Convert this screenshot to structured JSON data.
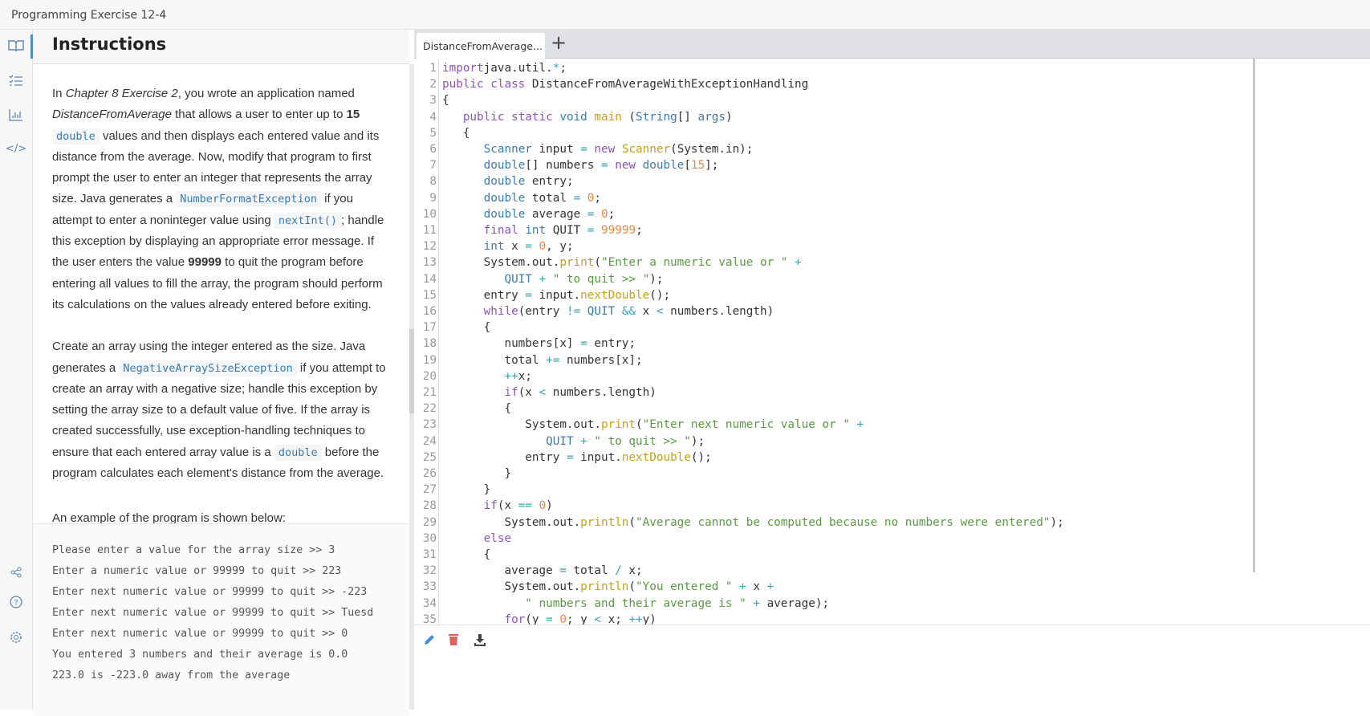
{
  "window": {
    "title": "Programming Exercise 12-4"
  },
  "rail": {
    "icons": [
      "book-icon",
      "checklist-icon",
      "chart-icon",
      "code-icon",
      "share-icon",
      "help-icon",
      "settings-icon"
    ]
  },
  "instructions": {
    "heading": "Instructions",
    "paragraphs": [
      [
        {
          "t": "In "
        },
        {
          "t": "Chapter 8 Exercise 2",
          "i": 1
        },
        {
          "t": ", you wrote an application named "
        },
        {
          "t": "DistanceFromAverage",
          "i": 1
        },
        {
          "t": " that allows a user to enter up to "
        },
        {
          "t": "15",
          "b": 1
        },
        {
          "t": " "
        },
        {
          "t": "double",
          "c": 1
        },
        {
          "t": " values and then displays each entered value and its distance from the average. Now, modify that program to first prompt the user to enter an integer that represents the array size. Java generates a "
        },
        {
          "t": "NumberFormatException",
          "c": 1
        },
        {
          "t": " if you attempt to enter a noninteger value using "
        },
        {
          "t": "nextInt()",
          "c": 1
        },
        {
          "t": "; handle this exception by displaying an appropriate error message. If the user enters the value "
        },
        {
          "t": "99999",
          "b": 1
        },
        {
          "t": " to quit the program before entering all values to fill the array, the program should perform its calculations on the values already entered before exiting."
        }
      ],
      [
        {
          "t": "Create an array using the integer entered as the size. Java generates a "
        },
        {
          "t": "NegativeArraySizeException",
          "c": 1
        },
        {
          "t": " if you attempt to create an array with a negative size; handle this exception by setting the array size to a default value of five. If the array is created successfully, use exception-handling techniques to ensure that each entered array value is a "
        },
        {
          "t": "double",
          "c": 1
        },
        {
          "t": " before the program calculates each element's distance from the average."
        }
      ],
      [
        {
          "t": "An example of the program is shown below:"
        }
      ]
    ],
    "console": [
      "Please enter a value for the array size >> 3",
      "Enter a numeric value or 99999 to quit >> 223",
      "Enter next numeric value or 99999 to quit >> -223",
      "Enter next numeric value or 99999 to quit >> Tuesd",
      "Enter next numeric value or 99999 to quit >> 0",
      "You entered 3 numbers and their average is 0.0",
      "223.0 is -223.0 away from the average"
    ]
  },
  "editor": {
    "tab_label": "DistanceFromAverage...",
    "add_tab": "+",
    "toolbar": [
      "edit-icon",
      "delete-icon",
      "download-icon"
    ],
    "lines": [
      [
        [
          "k",
          "import"
        ],
        [
          "",
          "java.util."
        ],
        [
          "o",
          "*"
        ],
        [
          "",
          ";"
        ]
      ],
      [
        [
          "k",
          "public class"
        ],
        [
          "",
          "DistanceFromAverageWithExceptionHandling"
        ]
      ],
      [
        [
          "",
          "{"
        ]
      ],
      [
        [
          "",
          "   "
        ],
        [
          "k",
          "public static"
        ],
        [
          "",
          "",
          ""
        ],
        [
          "t",
          " void"
        ],
        [
          "",
          " "
        ],
        [
          "f",
          "main"
        ],
        [
          "",
          " ("
        ],
        [
          "t",
          "String"
        ],
        [
          "",
          "[] "
        ],
        [
          "t",
          "args"
        ],
        [
          "",
          ")"
        ]
      ],
      [
        [
          "",
          "   {"
        ]
      ],
      [
        [
          "",
          "      "
        ],
        [
          "t",
          "Scanner"
        ],
        [
          "",
          " input "
        ],
        [
          "o",
          "="
        ],
        [
          "",
          " "
        ],
        [
          "k",
          "new"
        ],
        [
          "",
          " "
        ],
        [
          "f",
          "Scanner"
        ],
        [
          "",
          "(System.in);"
        ]
      ],
      [
        [
          "",
          "      "
        ],
        [
          "t",
          "double"
        ],
        [
          "",
          "[] numbers "
        ],
        [
          "o",
          "="
        ],
        [
          "",
          " "
        ],
        [
          "k",
          "new"
        ],
        [
          "",
          " "
        ],
        [
          "t",
          "double"
        ],
        [
          "",
          "["
        ],
        [
          "n",
          "15"
        ],
        [
          "",
          "];"
        ]
      ],
      [
        [
          "",
          "      "
        ],
        [
          "t",
          "double"
        ],
        [
          "",
          " entry;"
        ]
      ],
      [
        [
          "",
          "      "
        ],
        [
          "t",
          "double"
        ],
        [
          "",
          " total "
        ],
        [
          "o",
          "="
        ],
        [
          "",
          " "
        ],
        [
          "n",
          "0"
        ],
        [
          "",
          ";"
        ]
      ],
      [
        [
          "",
          "      "
        ],
        [
          "t",
          "double"
        ],
        [
          "",
          " average "
        ],
        [
          "o",
          "="
        ],
        [
          "",
          " "
        ],
        [
          "n",
          "0"
        ],
        [
          "",
          ";"
        ]
      ],
      [
        [
          "",
          "      "
        ],
        [
          "k",
          "final"
        ],
        [
          "",
          " "
        ],
        [
          "t",
          "int"
        ],
        [
          "",
          " QUIT "
        ],
        [
          "o",
          "="
        ],
        [
          "",
          " "
        ],
        [
          "n",
          "99999"
        ],
        [
          "",
          ";"
        ]
      ],
      [
        [
          "",
          "      "
        ],
        [
          "t",
          "int"
        ],
        [
          "",
          " x "
        ],
        [
          "o",
          "="
        ],
        [
          "",
          " "
        ],
        [
          "n",
          "0"
        ],
        [
          "",
          ", y;"
        ]
      ],
      [
        [
          "",
          "      System.out."
        ],
        [
          "f",
          "print"
        ],
        [
          "",
          "("
        ],
        [
          "s",
          "\"Enter a numeric value or \""
        ],
        [
          "",
          " "
        ],
        [
          "o",
          "+"
        ]
      ],
      [
        [
          "",
          "         "
        ],
        [
          "t",
          "QUIT"
        ],
        [
          "",
          " "
        ],
        [
          "o",
          "+"
        ],
        [
          "",
          " "
        ],
        [
          "s",
          "\" to quit >> \""
        ],
        [
          "",
          ");"
        ]
      ],
      [
        [
          "",
          "      entry "
        ],
        [
          "o",
          "="
        ],
        [
          "",
          " input."
        ],
        [
          "f",
          "nextDouble"
        ],
        [
          "",
          "();"
        ]
      ],
      [
        [
          "",
          "      "
        ],
        [
          "k",
          "while"
        ],
        [
          "",
          "(entry "
        ],
        [
          "o",
          "!="
        ],
        [
          "",
          " "
        ],
        [
          "t",
          "QUIT"
        ],
        [
          "",
          " "
        ],
        [
          "o",
          "&&"
        ],
        [
          "",
          " x "
        ],
        [
          "o",
          "<"
        ],
        [
          "",
          " numbers.length)"
        ]
      ],
      [
        [
          "",
          "      {"
        ]
      ],
      [
        [
          "",
          "         numbers[x] "
        ],
        [
          "o",
          "="
        ],
        [
          "",
          " entry;"
        ]
      ],
      [
        [
          "",
          "         total "
        ],
        [
          "o",
          "+="
        ],
        [
          "",
          " numbers[x];"
        ]
      ],
      [
        [
          "",
          "         "
        ],
        [
          "o",
          "++"
        ],
        [
          "",
          "x;"
        ]
      ],
      [
        [
          "",
          "         "
        ],
        [
          "k",
          "if"
        ],
        [
          "",
          "(x "
        ],
        [
          "o",
          "<"
        ],
        [
          "",
          " numbers.length)"
        ]
      ],
      [
        [
          "",
          "         {"
        ]
      ],
      [
        [
          "",
          "            System.out."
        ],
        [
          "f",
          "print"
        ],
        [
          "",
          "("
        ],
        [
          "s",
          "\"Enter next numeric value or \""
        ],
        [
          "",
          " "
        ],
        [
          "o",
          "+"
        ]
      ],
      [
        [
          "",
          "               "
        ],
        [
          "t",
          "QUIT"
        ],
        [
          "",
          " "
        ],
        [
          "o",
          "+"
        ],
        [
          "",
          " "
        ],
        [
          "s",
          "\" to quit >> \""
        ],
        [
          "",
          ");"
        ]
      ],
      [
        [
          "",
          "            entry "
        ],
        [
          "o",
          "="
        ],
        [
          "",
          " input."
        ],
        [
          "f",
          "nextDouble"
        ],
        [
          "",
          "();"
        ]
      ],
      [
        [
          "",
          "         }"
        ]
      ],
      [
        [
          "",
          "      }"
        ]
      ],
      [
        [
          "",
          "      "
        ],
        [
          "k",
          "if"
        ],
        [
          "",
          "(x "
        ],
        [
          "o",
          "=="
        ],
        [
          "",
          " "
        ],
        [
          "n",
          "0"
        ],
        [
          "",
          ")"
        ]
      ],
      [
        [
          "",
          "         System.out."
        ],
        [
          "f",
          "println"
        ],
        [
          "",
          "("
        ],
        [
          "s",
          "\"Average cannot be computed because no numbers were entered\""
        ],
        [
          "",
          ");"
        ]
      ],
      [
        [
          "",
          "      "
        ],
        [
          "k",
          "else"
        ]
      ],
      [
        [
          "",
          "      {"
        ]
      ],
      [
        [
          "",
          "         average "
        ],
        [
          "o",
          "="
        ],
        [
          "",
          " total "
        ],
        [
          "o",
          "/"
        ],
        [
          "",
          " x;"
        ]
      ],
      [
        [
          "",
          "         System.out."
        ],
        [
          "f",
          "println"
        ],
        [
          "",
          "("
        ],
        [
          "s",
          "\"You entered \""
        ],
        [
          "",
          " "
        ],
        [
          "o",
          "+"
        ],
        [
          "",
          " x "
        ],
        [
          "o",
          "+"
        ]
      ],
      [
        [
          "",
          "            "
        ],
        [
          "s",
          "\" numbers and their average is \""
        ],
        [
          "",
          " "
        ],
        [
          "o",
          "+"
        ],
        [
          "",
          " average);"
        ]
      ],
      [
        [
          "",
          "         "
        ],
        [
          "k",
          "for"
        ],
        [
          "",
          "(y "
        ],
        [
          "o",
          "="
        ],
        [
          "",
          " "
        ],
        [
          "n",
          "0"
        ],
        [
          "",
          "; y "
        ],
        [
          "o",
          "<"
        ],
        [
          "",
          " x; "
        ],
        [
          "o",
          "++"
        ],
        [
          "",
          "y)"
        ]
      ]
    ]
  }
}
